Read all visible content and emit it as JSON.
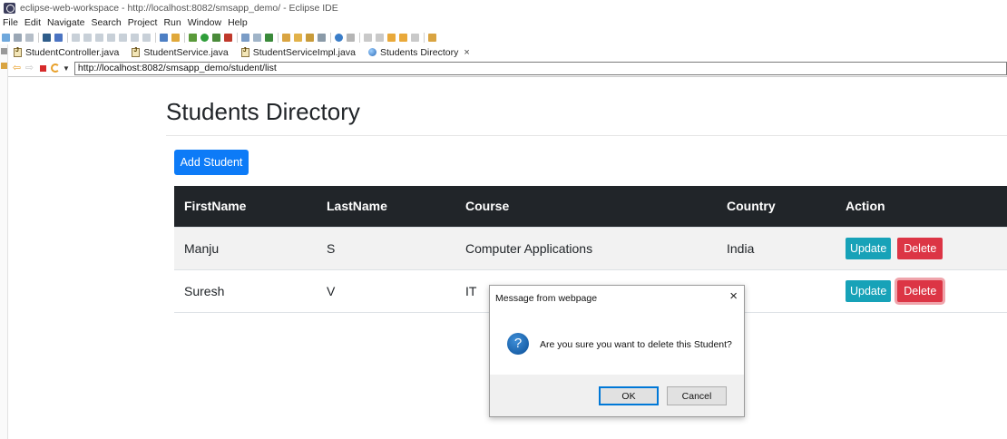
{
  "window": {
    "title": "eclipse-web-workspace - http://localhost:8082/smsapp_demo/ - Eclipse IDE"
  },
  "menu": [
    "File",
    "Edit",
    "Navigate",
    "Search",
    "Project",
    "Run",
    "Window",
    "Help"
  ],
  "editor_tabs": [
    {
      "label": "StudentController.java",
      "icon": "java-file-icon"
    },
    {
      "label": "StudentService.java",
      "icon": "java-file-icon"
    },
    {
      "label": "StudentServiceImpl.java",
      "icon": "java-file-icon"
    },
    {
      "label": "Students Directory",
      "icon": "globe-icon",
      "active": true,
      "close": "×"
    }
  ],
  "browser": {
    "url": "http://localhost:8082/smsapp_demo/student/list"
  },
  "page": {
    "title": "Students Directory",
    "add_button": "Add Student",
    "table": {
      "headers": [
        "FirstName",
        "LastName",
        "Course",
        "Country",
        "Action"
      ],
      "rows": [
        {
          "first": "Manju",
          "last": "S",
          "course": "Computer Applications",
          "country": "India",
          "update": "Update",
          "delete": "Delete"
        },
        {
          "first": "Suresh",
          "last": "V",
          "course": "IT",
          "country": "",
          "update": "Update",
          "delete": "Delete"
        }
      ]
    }
  },
  "dialog": {
    "title": "Message from webpage",
    "close": "×",
    "icon": "question-icon",
    "icon_glyph": "?",
    "message": "Are you sure you want to delete this Student?",
    "ok": "OK",
    "cancel": "Cancel"
  },
  "colors": {
    "primary": "#0d7bf7",
    "info": "#17a2b8",
    "danger": "#dc3545",
    "table_header": "#212529"
  }
}
